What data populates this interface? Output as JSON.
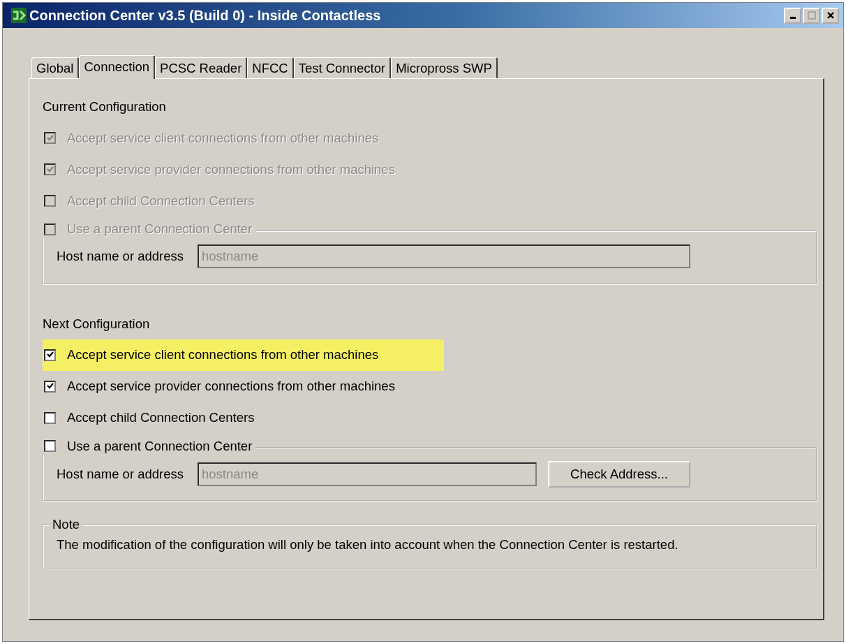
{
  "window": {
    "title": "Connection Center v3.5 (Build 0) - Inside Contactless"
  },
  "tabs": [
    {
      "label": "Global",
      "selected": false
    },
    {
      "label": "Connection",
      "selected": true
    },
    {
      "label": "PCSC Reader",
      "selected": false
    },
    {
      "label": "NFCC",
      "selected": false
    },
    {
      "label": "Test Connector",
      "selected": false
    },
    {
      "label": "Micropross SWP",
      "selected": false
    }
  ],
  "sections": [
    {
      "heading": "Current Configuration",
      "disabled": true,
      "options": [
        {
          "label": "Accept service client connections from other machines",
          "checked": true,
          "highlighted": false
        },
        {
          "label": "Accept service provider connections from other machines",
          "checked": true,
          "highlighted": false
        },
        {
          "label": "Accept child Connection Centers",
          "checked": false,
          "highlighted": false
        }
      ],
      "parent": {
        "label": "Use a parent Connection Center",
        "checked": false,
        "field_label": "Host name or address",
        "field": {
          "placeholder": "hostname",
          "disabled": true
        }
      }
    },
    {
      "heading": "Next Configuration",
      "disabled": false,
      "options": [
        {
          "label": "Accept service client connections from other machines",
          "checked": true,
          "highlighted": true
        },
        {
          "label": "Accept service provider connections from other machines",
          "checked": true,
          "highlighted": false
        },
        {
          "label": "Accept child Connection Centers",
          "checked": false,
          "highlighted": false
        }
      ],
      "parent": {
        "label": "Use a parent Connection Center",
        "checked": false,
        "field_label": "Host name or address",
        "field": {
          "placeholder": "hostname",
          "disabled": true
        },
        "button": "Check Address..."
      }
    }
  ],
  "note": {
    "title": "Note",
    "text": "The modification of the configuration will only be taken into account when the Connection Center is restarted."
  }
}
